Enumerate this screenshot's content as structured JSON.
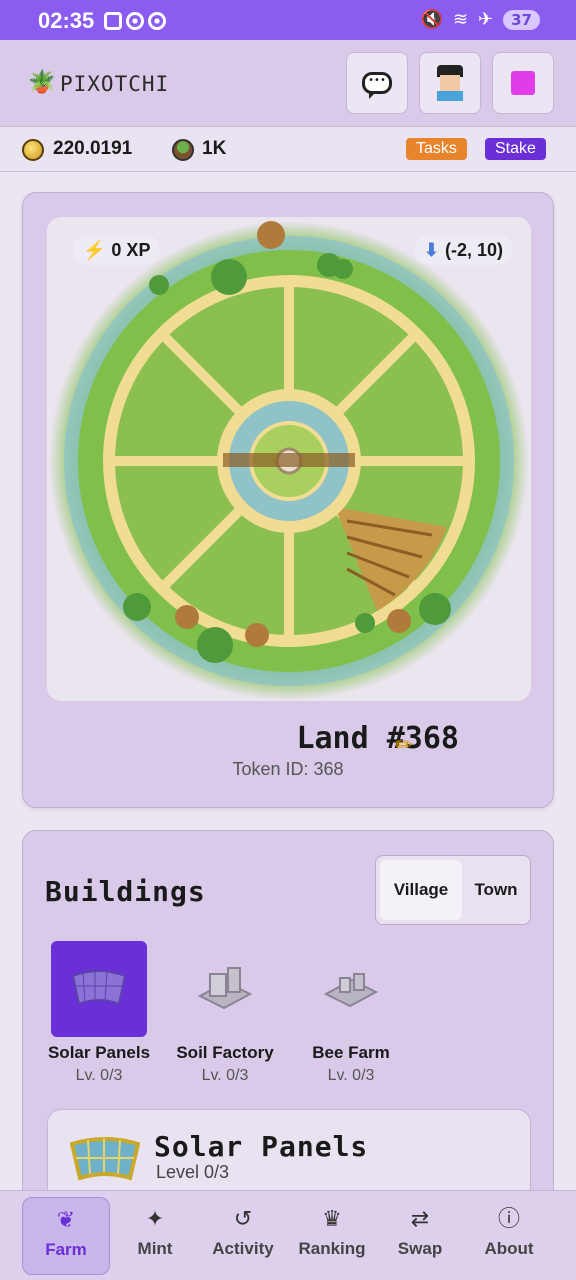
{
  "status_bar": {
    "time": "02:35",
    "battery": "37"
  },
  "header": {
    "title": "PIXOTCHI",
    "accent_color": "#e03ce8"
  },
  "balances": {
    "token_balance": "220.0191",
    "land_count": "1K",
    "tasks_label": "Tasks",
    "stake_label": "Stake"
  },
  "land": {
    "xp": "0 XP",
    "coordinates": "(-2, 10)",
    "name": "Land #368",
    "token_id": "Token ID: 368"
  },
  "buildings": {
    "title": "Buildings",
    "tabs": [
      {
        "label": "Village",
        "selected": true
      },
      {
        "label": "Town",
        "selected": false
      }
    ],
    "items": [
      {
        "name": "Solar Panels",
        "level": "Lv. 0/3",
        "selected": true
      },
      {
        "name": "Soil Factory",
        "level": "Lv. 0/3",
        "selected": false
      },
      {
        "name": "Bee Farm",
        "level": "Lv. 0/3",
        "selected": false
      }
    ],
    "detail": {
      "title": "Solar Panels",
      "level": "Level 0/3"
    }
  },
  "nav": {
    "items": [
      {
        "label": "Farm",
        "icon": "leaf-icon",
        "active": true
      },
      {
        "label": "Mint",
        "icon": "sparkles-icon",
        "active": false
      },
      {
        "label": "Activity",
        "icon": "history-icon",
        "active": false
      },
      {
        "label": "Ranking",
        "icon": "trophy-icon",
        "active": false
      },
      {
        "label": "Swap",
        "icon": "swap-icon",
        "active": false
      },
      {
        "label": "About",
        "icon": "info-icon",
        "active": false
      }
    ]
  }
}
